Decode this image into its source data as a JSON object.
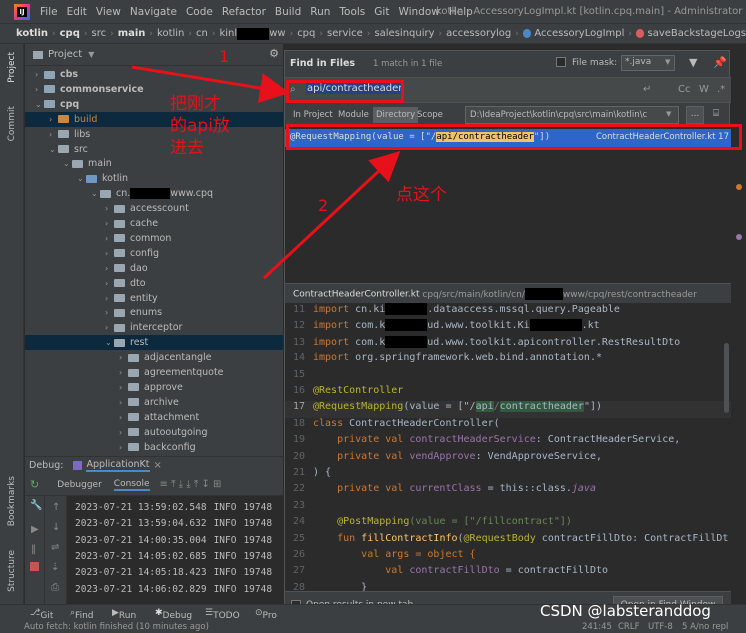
{
  "window": {
    "menu": [
      "File",
      "Edit",
      "View",
      "Navigate",
      "Code",
      "Refactor",
      "Build",
      "Run",
      "Tools",
      "Git",
      "Window",
      "Help"
    ],
    "title": "kotlin - AccessoryLogImpl.kt [kotlin.cpq.main] - Administrator"
  },
  "breadcrumb": {
    "items": [
      "kotlin",
      "cpq",
      "src",
      "main",
      "kotlin",
      "cn",
      "kinl",
      "ww",
      "cpq",
      "service",
      "salesinquiry",
      "accessorylog",
      "AccessoryLogImpl",
      "saveBackstageLogs"
    ]
  },
  "project_panel": {
    "title": "Project",
    "tree": [
      {
        "label": "cbs",
        "depth": 0,
        "icon": "module-folder"
      },
      {
        "label": "commonservice",
        "depth": 0,
        "icon": "module-folder"
      },
      {
        "label": "cpq",
        "depth": 0,
        "icon": "module-folder"
      },
      {
        "label": "build",
        "depth": 1,
        "icon": "excluded-folder"
      },
      {
        "label": "libs",
        "depth": 1,
        "icon": "folder"
      },
      {
        "label": "src",
        "depth": 1,
        "icon": "folder"
      },
      {
        "label": "main",
        "depth": 2,
        "icon": "folder"
      },
      {
        "label": "kotlin",
        "depth": 3,
        "icon": "source-folder"
      },
      {
        "label": "cn.",
        "suffix": "www.cpq",
        "depth": 4,
        "icon": "package"
      },
      {
        "label": "accesscount",
        "depth": 5,
        "icon": "package"
      },
      {
        "label": "cache",
        "depth": 5,
        "icon": "package"
      },
      {
        "label": "common",
        "depth": 5,
        "icon": "package"
      },
      {
        "label": "config",
        "depth": 5,
        "icon": "package"
      },
      {
        "label": "dao",
        "depth": 5,
        "icon": "package"
      },
      {
        "label": "dto",
        "depth": 5,
        "icon": "package"
      },
      {
        "label": "entity",
        "depth": 5,
        "icon": "package"
      },
      {
        "label": "enums",
        "depth": 5,
        "icon": "package"
      },
      {
        "label": "interceptor",
        "depth": 5,
        "icon": "package"
      },
      {
        "label": "rest",
        "depth": 5,
        "icon": "package"
      },
      {
        "label": "adjacentangle",
        "depth": 6,
        "icon": "package"
      },
      {
        "label": "agreementquote",
        "depth": 6,
        "icon": "package"
      },
      {
        "label": "approve",
        "depth": 6,
        "icon": "package"
      },
      {
        "label": "archive",
        "depth": 6,
        "icon": "package"
      },
      {
        "label": "attachment",
        "depth": 6,
        "icon": "package"
      },
      {
        "label": "autooutgoing",
        "depth": 6,
        "icon": "package"
      },
      {
        "label": "backconfig",
        "depth": 6,
        "icon": "package"
      }
    ]
  },
  "left_strip": {
    "project": "Project",
    "commit": "Commit",
    "bookmarks": "Bookmarks",
    "structure": "Structure"
  },
  "debug": {
    "label": "Debug:",
    "config": "ApplicationKt",
    "tabs": [
      "Debugger",
      "Console"
    ],
    "log": [
      {
        "time": "2023-07-21 13:59:02.548",
        "level": "INFO",
        "pid": "19748"
      },
      {
        "time": "2023-07-21 13:59:04.632",
        "level": "INFO",
        "pid": "19748"
      },
      {
        "time": "2023-07-21 14:00:35.004",
        "level": "INFO",
        "pid": "19748"
      },
      {
        "time": "2023-07-21 14:05:02.685",
        "level": "INFO",
        "pid": "19748"
      },
      {
        "time": "2023-07-21 14:05:18.423",
        "level": "INFO",
        "pid": "19748"
      },
      {
        "time": "2023-07-21 14:06:02.829",
        "level": "INFO",
        "pid": "19748"
      }
    ]
  },
  "find": {
    "title": "Find in Files",
    "match_info": "1 match in 1 file",
    "file_mask_label": "File mask:",
    "file_mask_value": "*.java",
    "query": "api/contractheader",
    "scopes": [
      "In Project",
      "Module",
      "Directory",
      "Scope"
    ],
    "active_scope": "Directory",
    "directory_path": "D:\\IdeaProject\\kotlin\\cpq\\src\\main\\kotlin\\c",
    "result": {
      "prefix": "@RequestMapping(value = [\"/",
      "match": "api/contractheader",
      "suffix": "\"])",
      "file": "ContractHeaderController.kt 17"
    },
    "preview_header": {
      "file": "ContractHeaderController.kt",
      "path_prefix": "cpq/src/main/kotlin/cn/",
      "path_suffix": "www/cpq/rest/contractheader"
    },
    "open_in_new_tab": "Open results in new tab",
    "open_button": "Open in Find Window",
    "cc": "Cc",
    "w": "W"
  },
  "code": {
    "line_numbers": [
      "11",
      "12",
      "13",
      "14",
      "15",
      "16",
      "17",
      "18",
      "19",
      "20",
      "21",
      "22",
      "23",
      "24",
      "25",
      "26",
      "27",
      "28"
    ],
    "import1_a": "cn.ki",
    "import1_b": ".dataaccess.mssql.query.Pageable",
    "import2_a": "com.k",
    "import2_b": "ud.www.toolkit.Ki",
    "import2_c": ".kt",
    "import3_a": "com.k",
    "import3_b": "ud.www.toolkit.apicontroller.RestResultDto",
    "import4": "org.springframework.web.bind.annotation.*",
    "rest_controller": "@RestController",
    "request_mapping": "@RequestMapping",
    "request_value_prefix": "(value = [\"/",
    "request_value_a": "api",
    "request_value_sep": "/",
    "request_value_b": "contractheader",
    "request_value_suffix": "\"])",
    "class_name": "ContractHeaderController(",
    "field1": "contractHeaderService",
    "type1": ": ContractHeaderService,",
    "field2": "vendApprove",
    "type2": ": VendApproveService,",
    "close_ctor": ") {",
    "field3": "currentClass",
    "expr3": " = this::class.",
    "expr3b": "java",
    "post_mapping": "@PostMapping",
    "post_value": "(value = [\"/fillcontract\"])",
    "fun_name": "fillContractInfo",
    "fun_sig_a": "(",
    "fun_sig_ann": "@RequestBody",
    "fun_sig_b": " contractFillDto: ContractFillDt",
    "args_line": "val args = object {",
    "fill_line_a": "val ",
    "fill_line_field": "contractFillDto",
    "fill_line_b": " = contractFillDto"
  },
  "annotations": {
    "num1": "1",
    "num2": "2",
    "text1": "把刚才\n的api放\n进去",
    "text2": "点这个"
  },
  "bottom_tools": [
    "Git",
    "Find",
    "Run",
    "Debug",
    "TODO",
    "Pro"
  ],
  "status": {
    "left": "Auto fetch: kotlin finished (10 minutes ago)",
    "position": "241:45",
    "line_sep": "CRLF",
    "encoding": "UTF-8",
    "warnings": "5 A/no repl"
  },
  "watermark": "CSDN @labsteranddog",
  "colors": {
    "annotation_red": "#e8101a",
    "selection_blue": "#2f65ca",
    "match_yellow": "#f0c36b"
  }
}
